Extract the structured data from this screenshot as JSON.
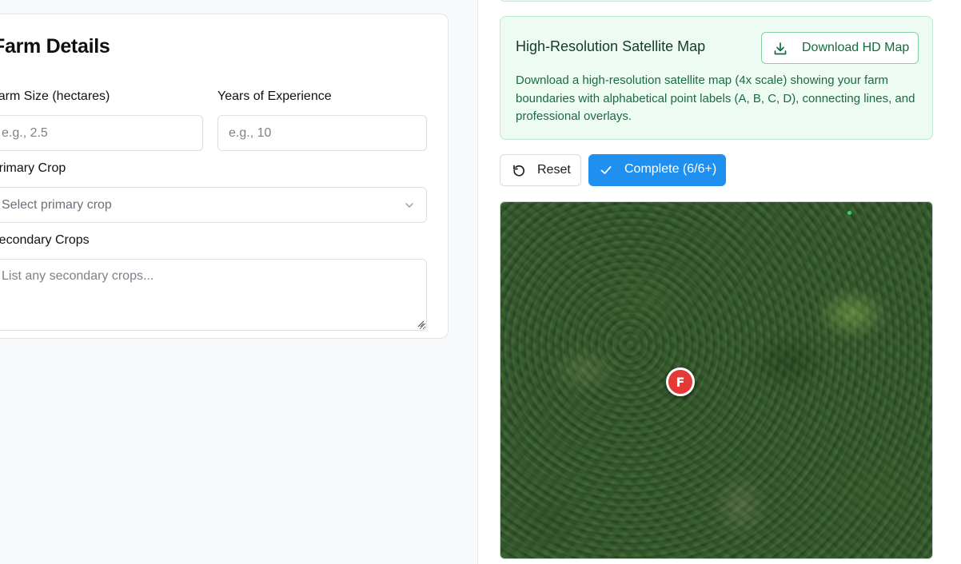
{
  "farm_details": {
    "title": "Farm Details",
    "farm_size": {
      "label": "Farm Size (hectares)",
      "placeholder": "e.g., 2.5"
    },
    "years_experience": {
      "label": "Years of Experience",
      "placeholder": "e.g., 10"
    },
    "primary_crop": {
      "label": "Primary Crop",
      "selected": "Select primary crop"
    },
    "secondary_crops": {
      "label": "Secondary Crops",
      "placeholder": "List any secondary crops..."
    }
  },
  "hd_map": {
    "title": "High-Resolution Satellite Map",
    "download_label": "Download HD Map",
    "description": "Download a high-resolution satellite map (4x scale) showing your farm boundaries with alphabetical point labels (A, B, C, D), connecting lines, and professional overlays."
  },
  "actions": {
    "reset_label": "Reset",
    "complete_label": "Complete (6/6+)"
  },
  "map": {
    "marker_label": "F"
  },
  "colors": {
    "accent_blue": "#1f8ff0",
    "success_green": "#156b3e",
    "marker_red": "#e53935"
  }
}
